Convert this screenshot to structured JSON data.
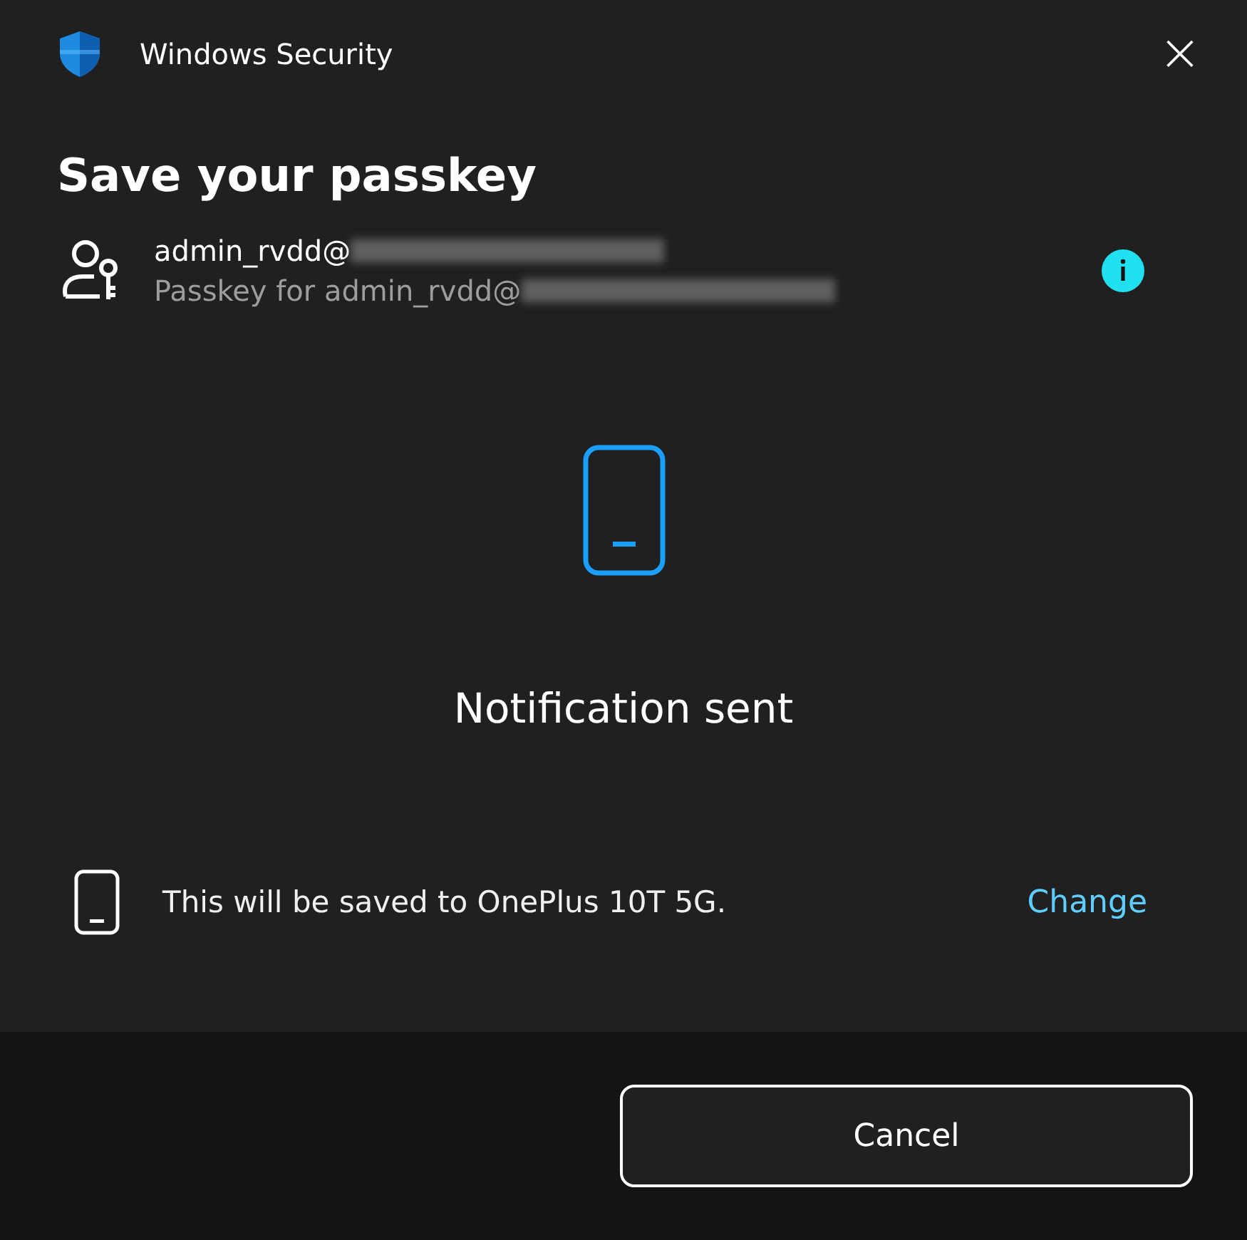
{
  "window": {
    "title": "Windows Security",
    "close": "×"
  },
  "heading": "Save your passkey",
  "account": {
    "name": "admin_rvdd@",
    "detail": "Passkey for admin_rvdd@",
    "redacted": true
  },
  "status": "Notification sent",
  "device": {
    "text": "This will be saved to OnePlus 10T 5G.",
    "link": "Change"
  },
  "buttons": [
    "Cancel"
  ]
}
